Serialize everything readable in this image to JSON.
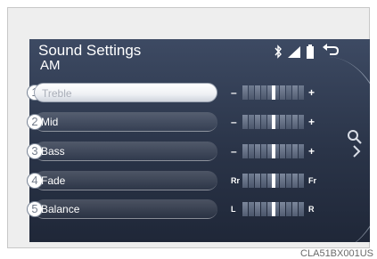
{
  "header": {
    "title": "Sound Settings",
    "subtitle": "AM"
  },
  "icons": {
    "bluetooth": "bluetooth-icon",
    "signal": "signal-strength-icon",
    "battery": "battery-icon",
    "back": "back-arrow-icon",
    "scroll": "zoom-scroll-icon"
  },
  "settings": [
    {
      "number": "1",
      "label": "Treble",
      "left": "–",
      "right": "+",
      "level": 0.5,
      "selected": true
    },
    {
      "number": "2",
      "label": "Mid",
      "left": "–",
      "right": "+",
      "level": 0.5,
      "selected": false
    },
    {
      "number": "3",
      "label": "Bass",
      "left": "–",
      "right": "+",
      "level": 0.5,
      "selected": false
    },
    {
      "number": "4",
      "label": "Fade",
      "left": "Rr",
      "right": "Fr",
      "level": 0.5,
      "selected": false
    },
    {
      "number": "5",
      "label": "Balance",
      "left": "L",
      "right": "R",
      "level": 0.5,
      "selected": false
    }
  ],
  "caption": "CLA51BX001US",
  "colors": {
    "screen": "#2a3448",
    "accent": "#ffffff",
    "callout": "#7a8596"
  }
}
